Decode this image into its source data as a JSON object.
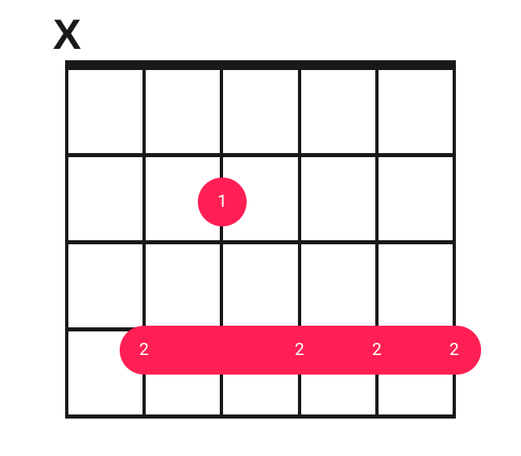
{
  "chart_data": {
    "type": "guitar-chord",
    "strings": 6,
    "frets_shown": 4,
    "open_muted": [
      "X",
      null,
      null,
      null,
      null,
      null
    ],
    "fingerings": [
      {
        "type": "dot",
        "string": 3,
        "fret": 2,
        "finger": "1"
      },
      {
        "type": "barre",
        "from_string": 2,
        "to_string": 6,
        "fret": 4,
        "finger": "2",
        "labels_at_strings": [
          2,
          4,
          5,
          6
        ]
      }
    ],
    "colors": {
      "grid": "#191919",
      "marker": "#ff1f54",
      "marker_text": "#ffffff"
    }
  },
  "markers": {
    "mute_label": "X",
    "dot_finger_1": "1",
    "barre_finger_2": "2"
  }
}
